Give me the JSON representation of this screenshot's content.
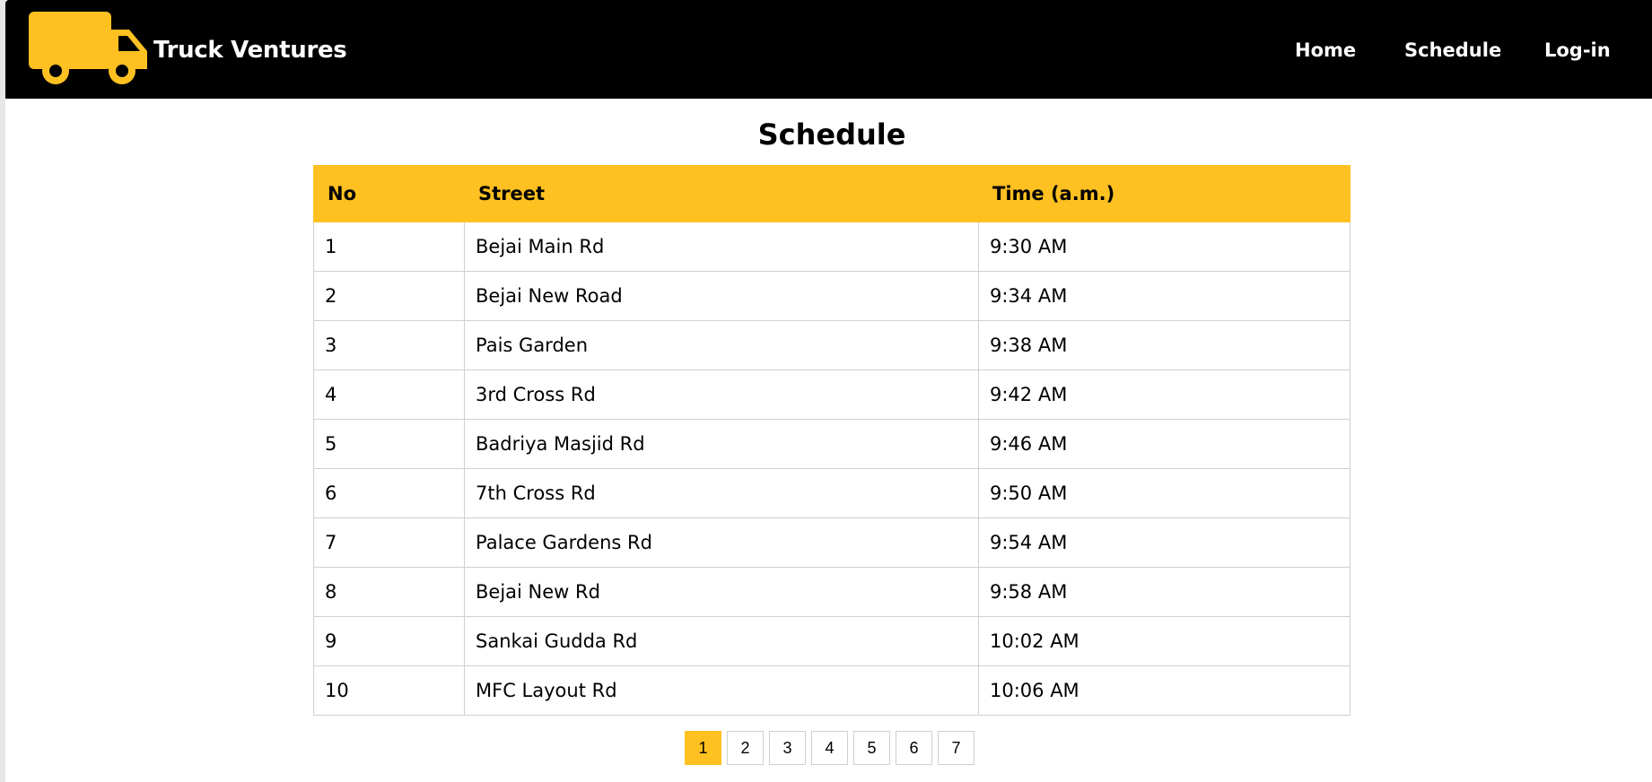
{
  "brand": {
    "name": "Truck Ventures",
    "logo_icon": "truck-icon",
    "accent_color": "#FFC121"
  },
  "nav": {
    "links": [
      {
        "label": "Home"
      },
      {
        "label": "Schedule"
      },
      {
        "label": "Log-in"
      }
    ]
  },
  "page": {
    "title": "Schedule"
  },
  "table": {
    "headers": [
      "No",
      "Street",
      "Time (a.m.)"
    ],
    "rows": [
      {
        "no": "1",
        "street": "Bejai Main Rd",
        "time": "9:30 AM"
      },
      {
        "no": "2",
        "street": "Bejai New Road",
        "time": "9:34 AM"
      },
      {
        "no": "3",
        "street": "Pais Garden",
        "time": "9:38 AM"
      },
      {
        "no": "4",
        "street": "3rd Cross Rd",
        "time": "9:42 AM"
      },
      {
        "no": "5",
        "street": "Badriya Masjid Rd",
        "time": "9:46 AM"
      },
      {
        "no": "6",
        "street": "7th Cross Rd",
        "time": "9:50 AM"
      },
      {
        "no": "7",
        "street": "Palace Gardens Rd",
        "time": "9:54 AM"
      },
      {
        "no": "8",
        "street": "Bejai New Rd",
        "time": "9:58 AM"
      },
      {
        "no": "9",
        "street": "Sankai Gudda Rd",
        "time": "10:02 AM"
      },
      {
        "no": "10",
        "street": "MFC Layout Rd",
        "time": "10:06 AM"
      }
    ]
  },
  "pagination": {
    "current": "1",
    "pages": [
      "1",
      "2",
      "3",
      "4",
      "5",
      "6",
      "7"
    ]
  }
}
